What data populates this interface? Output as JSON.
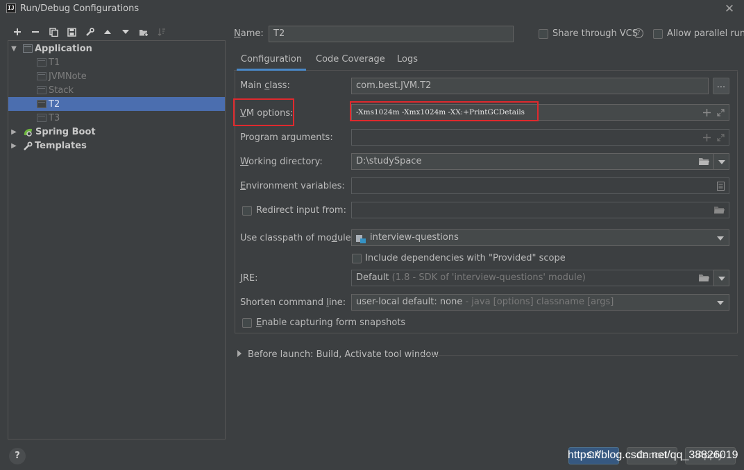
{
  "window": {
    "title": "Run/Debug Configurations",
    "app_icon_text": "IJ"
  },
  "toolbar": {
    "icons": [
      "add-icon",
      "remove-icon",
      "copy-icon",
      "save-icon",
      "wrench-icon",
      "move-up-icon",
      "move-down-icon",
      "new-folder-icon",
      "sort-icon"
    ]
  },
  "tree": {
    "application": "Application",
    "items": [
      "T1",
      "JVMNote",
      "Stack",
      "T2",
      "T3"
    ],
    "selected": "T2",
    "spring_boot": "Spring Boot",
    "templates": "Templates"
  },
  "header": {
    "name_label": "Name:",
    "name_value": "T2",
    "share_vcs": "Share through VCS",
    "allow_parallel": "Allow parallel run"
  },
  "tabs": [
    "Configuration",
    "Code Coverage",
    "Logs"
  ],
  "form": {
    "main_class_label": "Main class:",
    "main_class_value": "com.best.JVM.T2",
    "browse_label": "...",
    "vm_options_label": "VM options:",
    "vm_options_value": "-Xms1024m -Xmx1024m -XX:+PrintGCDetails",
    "program_args_label": "Program arguments:",
    "program_args_value": "",
    "working_dir_label": "Working directory:",
    "working_dir_value": "D:\\studySpace",
    "env_vars_label": "Environment variables:",
    "env_vars_value": "",
    "redirect_input_label": "Redirect input from:",
    "redirect_input_value": "",
    "classpath_label": "Use classpath of module:",
    "classpath_value": "interview-questions",
    "include_deps_label": "Include dependencies with \"Provided\" scope",
    "jre_label": "JRE:",
    "jre_value": "Default",
    "jre_hint": "(1.8 - SDK of 'interview-questions' module)",
    "shorten_label": "Shorten command line:",
    "shorten_value": "user-local default: none",
    "shorten_hint": "- java [options] classname [args]",
    "snapshots_label": "Enable capturing form snapshots"
  },
  "before_launch": "Before launch: Build, Activate tool window",
  "footer": {
    "help": "?",
    "ok": "OK",
    "cancel": "Cancel",
    "apply": "Apply",
    "watermark": "https://blog.csdn.net/qq_38826019"
  },
  "colors": {
    "selection": "#4b6eaf",
    "highlight_box": "#e0292d",
    "ok_button": "#365880"
  }
}
